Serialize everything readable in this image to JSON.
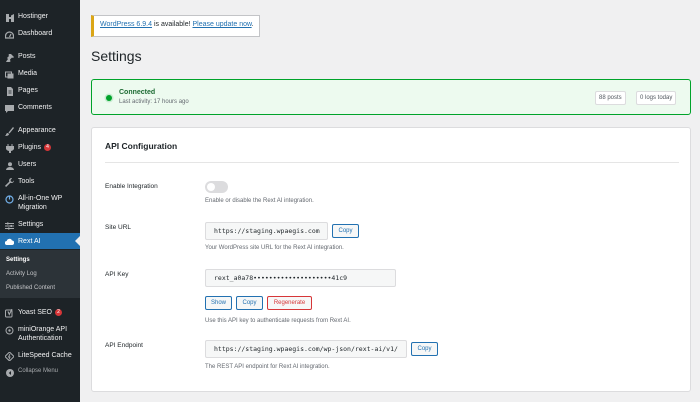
{
  "sidebar": {
    "items": [
      {
        "icon": "hostinger-icon",
        "label": "Hostinger"
      },
      {
        "icon": "dashboard-icon",
        "label": "Dashboard"
      },
      {
        "icon": "pin-icon",
        "label": "Posts"
      },
      {
        "icon": "media-icon",
        "label": "Media"
      },
      {
        "icon": "page-icon",
        "label": "Pages"
      },
      {
        "icon": "comment-icon",
        "label": "Comments"
      },
      {
        "icon": "brush-icon",
        "label": "Appearance"
      },
      {
        "icon": "plugin-icon",
        "label": "Plugins",
        "badge": "4"
      },
      {
        "icon": "user-icon",
        "label": "Users"
      },
      {
        "icon": "wrench-icon",
        "label": "Tools"
      },
      {
        "icon": "migration-icon",
        "label": "All-in-One WP Migration"
      },
      {
        "icon": "settings-icon",
        "label": "Settings"
      },
      {
        "icon": "cloud-icon",
        "label": "Rext AI"
      },
      {
        "icon": "yoast-icon",
        "label": "Yoast SEO",
        "badge": "2"
      },
      {
        "icon": "miniorange-icon",
        "label": "miniOrange API Authentication"
      },
      {
        "icon": "litespeed-icon",
        "label": "LiteSpeed Cache"
      },
      {
        "icon": "collapse-icon",
        "label": "Collapse Menu"
      }
    ],
    "submenu": [
      "Settings",
      "Activity Log",
      "Published Content"
    ]
  },
  "notice": {
    "link1": "WordPress 6.9.4",
    "middle": " is available! ",
    "link2": "Please update now",
    "end": "."
  },
  "page_title": "Settings",
  "status": {
    "title": "Connected",
    "subtitle": "Last activity: 17 hours ago",
    "posts": "88 posts",
    "logs": "0 logs today",
    "color": "#00a32a"
  },
  "card": {
    "title": "API Configuration",
    "enable": {
      "label": "Enable Integration",
      "desc": "Enable or disable the Rext AI integration."
    },
    "site_url": {
      "label": "Site URL",
      "value": "https://staging.wpaegis.com",
      "copy": "Copy",
      "desc": "Your WordPress site URL for the Rext AI integration."
    },
    "api_key": {
      "label": "API Key",
      "value": "rext_a0a78••••••••••••••••••••41c9",
      "show": "Show",
      "copy": "Copy",
      "regenerate": "Regenerate",
      "desc": "Use this API key to authenticate requests from Rext AI."
    },
    "endpoint": {
      "label": "API Endpoint",
      "value": "https://staging.wpaegis.com/wp-json/rext-ai/v1/",
      "copy": "Copy",
      "desc": "The REST API endpoint for Rext AI integration."
    }
  },
  "colors": {
    "accent": "#2271b1",
    "sidebar": "#1d2327",
    "danger": "#d63638"
  }
}
